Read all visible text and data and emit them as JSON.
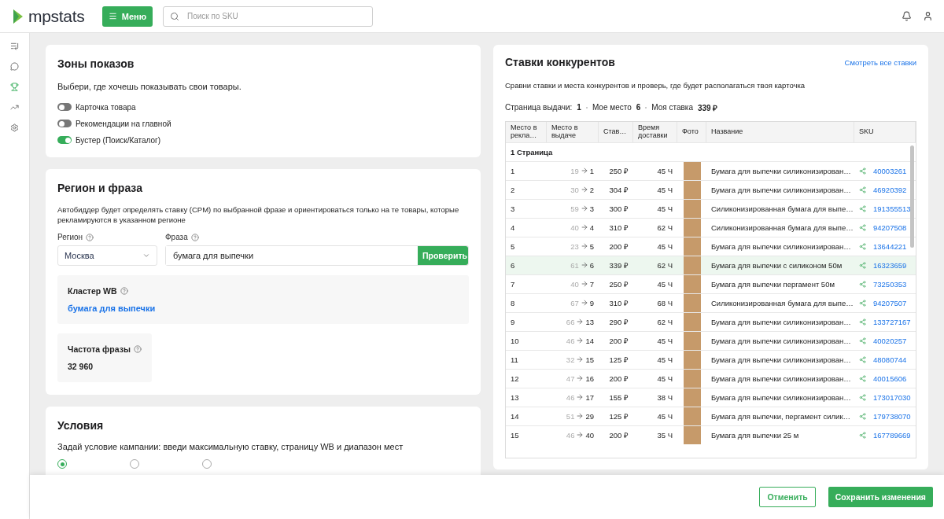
{
  "header": {
    "logo": "mpstats",
    "menu_button": "Меню",
    "search": {
      "placeholder": "Поиск по SKU"
    }
  },
  "sidebar": {
    "items": [
      {
        "selected": false
      },
      {
        "selected": false
      },
      {
        "selected": true
      },
      {
        "selected": false
      },
      {
        "selected": false
      }
    ]
  },
  "zones": {
    "title": "Зоны показов",
    "description": "Выбери, где хочешь показывать свои товары.",
    "toggles": [
      {
        "label": "Карточка товара",
        "on": false
      },
      {
        "label": "Рекомендации на главной",
        "on": false
      },
      {
        "label": "Бустер (Поиск/Каталог)",
        "on": true
      }
    ]
  },
  "region_phrase": {
    "title": "Регион и фраза",
    "description": "Автобиддер будет определять ставку (CPM) по выбранной фразе и ориентироваться только на те товары, которые рекламируются в указанном регионе",
    "region_label": "Регион",
    "region_value": "Москва",
    "phrase_label": "Фраза",
    "phrase_value": "бумага для выпечки",
    "check_button": "Проверить",
    "cluster_label": "Кластер WB",
    "cluster_link": "бумага для выпечки",
    "frequency_label": "Частота фразы",
    "frequency_value": "32 960"
  },
  "conditions": {
    "title": "Условия",
    "description": "Задай условие кампании: введи максимальную ставку, страницу WB и диапазон мест",
    "radios": [
      {
        "selected": true
      },
      {
        "selected": false
      },
      {
        "selected": false
      }
    ]
  },
  "competitors": {
    "title": "Ставки конкурентов",
    "view_all": "Смотреть все ставки",
    "description": "Сравни ставки и места конкурентов и проверь, где будет располагаться твоя карточка",
    "summary": [
      {
        "label": "Страница выдачи:",
        "value": "1"
      },
      {
        "label": "Мое место",
        "value": "6"
      },
      {
        "label": "Моя ставка",
        "value": "339 ₽"
      }
    ],
    "table": {
      "columns": [
        "Место в рекла…",
        "Место в выдаче",
        "Став…",
        "Время доставки",
        "Фото",
        "Название",
        "SKU"
      ],
      "group": "1 Страница",
      "rows": [
        {
          "ad_place": "1",
          "from": "19",
          "to": "1",
          "bid": "250 ₽",
          "delivery": "45 Ч",
          "name": "Бумага для выпечки силиконизирован…",
          "sku": "40003261",
          "selected": false
        },
        {
          "ad_place": "2",
          "from": "30",
          "to": "2",
          "bid": "304 ₽",
          "delivery": "45 Ч",
          "name": "Бумага для выпечки силиконизирован…",
          "sku": "46920392",
          "selected": false
        },
        {
          "ad_place": "3",
          "from": "59",
          "to": "3",
          "bid": "300 ₽",
          "delivery": "45 Ч",
          "name": "Силиконизированная бумага для выпе…",
          "sku": "191355513",
          "selected": false
        },
        {
          "ad_place": "4",
          "from": "40",
          "to": "4",
          "bid": "310 ₽",
          "delivery": "62 Ч",
          "name": "Силиконизированная бумага для выпе…",
          "sku": "94207508",
          "selected": false
        },
        {
          "ad_place": "5",
          "from": "23",
          "to": "5",
          "bid": "200 ₽",
          "delivery": "45 Ч",
          "name": "Бумага для выпечки силиконизирован…",
          "sku": "13644221",
          "selected": false
        },
        {
          "ad_place": "6",
          "from": "61",
          "to": "6",
          "bid": "339 ₽",
          "delivery": "62 Ч",
          "name": "Бумага для выпечки с силиконом 50м",
          "sku": "16323659",
          "selected": true
        },
        {
          "ad_place": "7",
          "from": "40",
          "to": "7",
          "bid": "250 ₽",
          "delivery": "45 Ч",
          "name": "Бумага для выпечки пергамент 50м",
          "sku": "73250353",
          "selected": false
        },
        {
          "ad_place": "8",
          "from": "67",
          "to": "9",
          "bid": "310 ₽",
          "delivery": "68 Ч",
          "name": "Силиконизированная бумага для выпе…",
          "sku": "94207507",
          "selected": false
        },
        {
          "ad_place": "9",
          "from": "66",
          "to": "13",
          "bid": "290 ₽",
          "delivery": "62 Ч",
          "name": "Бумага для выпечки силиконизирован…",
          "sku": "133727167",
          "selected": false
        },
        {
          "ad_place": "10",
          "from": "46",
          "to": "14",
          "bid": "200 ₽",
          "delivery": "45 Ч",
          "name": "Бумага для выпечки силиконизирован…",
          "sku": "40020257",
          "selected": false
        },
        {
          "ad_place": "11",
          "from": "32",
          "to": "15",
          "bid": "125 ₽",
          "delivery": "45 Ч",
          "name": "Бумага для выпечки силиконизирован…",
          "sku": "48080744",
          "selected": false
        },
        {
          "ad_place": "12",
          "from": "47",
          "to": "16",
          "bid": "200 ₽",
          "delivery": "45 Ч",
          "name": "Бумага для выпечки силиконизирован…",
          "sku": "40015606",
          "selected": false
        },
        {
          "ad_place": "13",
          "from": "46",
          "to": "17",
          "bid": "155 ₽",
          "delivery": "38 Ч",
          "name": "Бумага для выпечки силиконизирован…",
          "sku": "173017030",
          "selected": false
        },
        {
          "ad_place": "14",
          "from": "51",
          "to": "29",
          "bid": "125 ₽",
          "delivery": "45 Ч",
          "name": "Бумага для выпечки, пергамент силик…",
          "sku": "179738070",
          "selected": false
        },
        {
          "ad_place": "15",
          "from": "46",
          "to": "40",
          "bid": "200 ₽",
          "delivery": "35 Ч",
          "name": "Бумага для выпечки 25 м",
          "sku": "167789669",
          "selected": false
        }
      ]
    }
  },
  "footer": {
    "cancel": "Отменить",
    "save": "Сохранить изменения"
  }
}
